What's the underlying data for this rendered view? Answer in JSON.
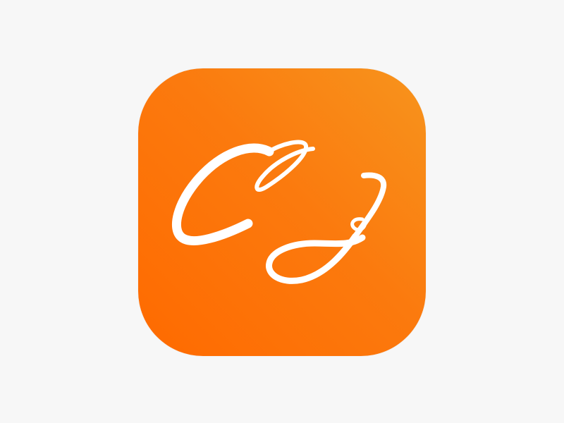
{
  "app_icon": {
    "monogram": "CJ",
    "icon_name": "cj-monogram-icon",
    "colors": {
      "background": "#f7f7f7",
      "gradient_top_right": "#f7941d",
      "gradient_bottom_left": "#ff6a00",
      "glyph": "#ffffff"
    }
  }
}
